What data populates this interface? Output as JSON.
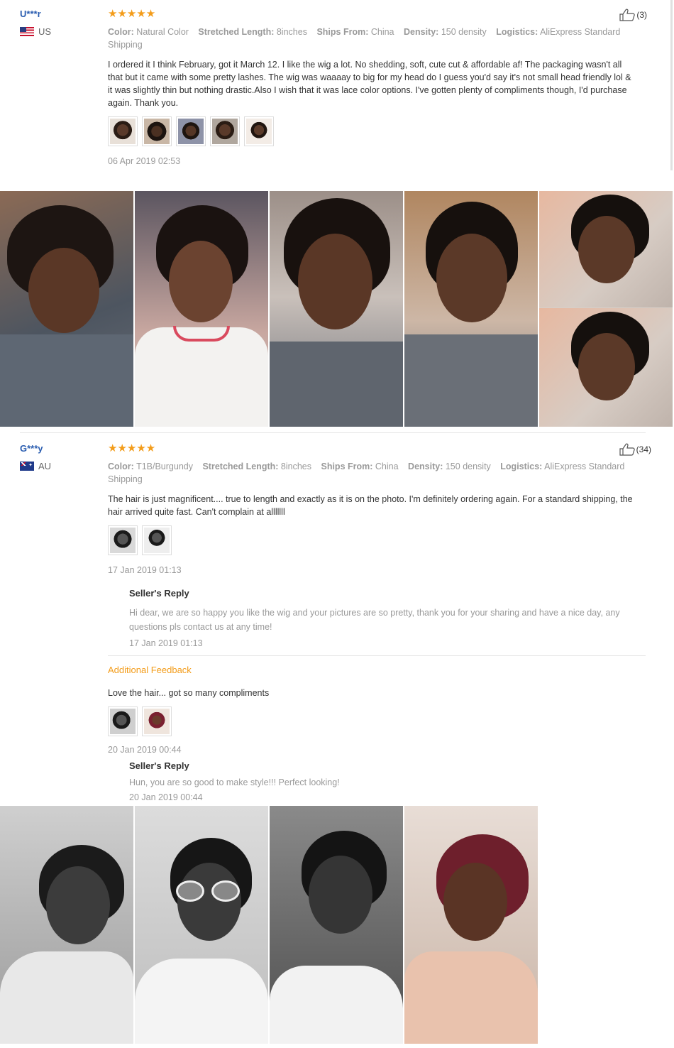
{
  "reviews": [
    {
      "user": "U***r",
      "country": "US",
      "stars": "★★★★★",
      "likes": "(3)",
      "attrs": [
        {
          "key": "Color:",
          "val": "Natural Color"
        },
        {
          "key": "Stretched Length:",
          "val": "8inches"
        },
        {
          "key": "Ships From:",
          "val": "China"
        },
        {
          "key": "Density:",
          "val": "150 density"
        },
        {
          "key": "Logistics:",
          "val": "AliExpress Standard Shipping"
        }
      ],
      "text": "I ordered it I think February, got it March 12. I like the wig a lot. No shedding, soft, cute cut & affordable af! The packaging wasn't all that but it came with some pretty lashes. The wig was waaaay to big for my head do I guess you'd say it's not small head friendly lol & it was slightly thin but nothing drastic.Also I wish that it was lace color options. I've gotten plenty of compliments though, I'd purchase again. Thank you.",
      "date": "06 Apr 2019 02:53"
    },
    {
      "user": "G***y",
      "country": "AU",
      "stars": "★★★★★",
      "likes": "(34)",
      "attrs": [
        {
          "key": "Color:",
          "val": "T1B/Burgundy"
        },
        {
          "key": "Stretched Length:",
          "val": "8inches"
        },
        {
          "key": "Ships From:",
          "val": "China"
        },
        {
          "key": "Density:",
          "val": "150 density"
        },
        {
          "key": "Logistics:",
          "val": "AliExpress Standard Shipping"
        }
      ],
      "text": "The hair is just magnificent.... true to length and exactly as it is on the photo. I'm definitely ordering again. For a standard shipping, the hair arrived quite fast. Can't complain at alllllll",
      "date": "17 Jan 2019 01:13",
      "reply": {
        "title": "Seller's Reply",
        "text": "Hi dear, we are so happy you like the wig and your pictures are so pretty, thank you for your sharing and have a nice day, any questions pls contact us at any time!",
        "date": "17 Jan 2019 01:13"
      },
      "additional": {
        "title": "Additional Feedback",
        "text": "Love the hair... got so many compliments",
        "date": "20 Jan 2019 00:44",
        "reply_title": "Seller's Reply",
        "reply_text": "Hun, you are so good to make style!!! Perfect looking!",
        "reply_date": "20 Jan 2019 00:44"
      }
    }
  ]
}
